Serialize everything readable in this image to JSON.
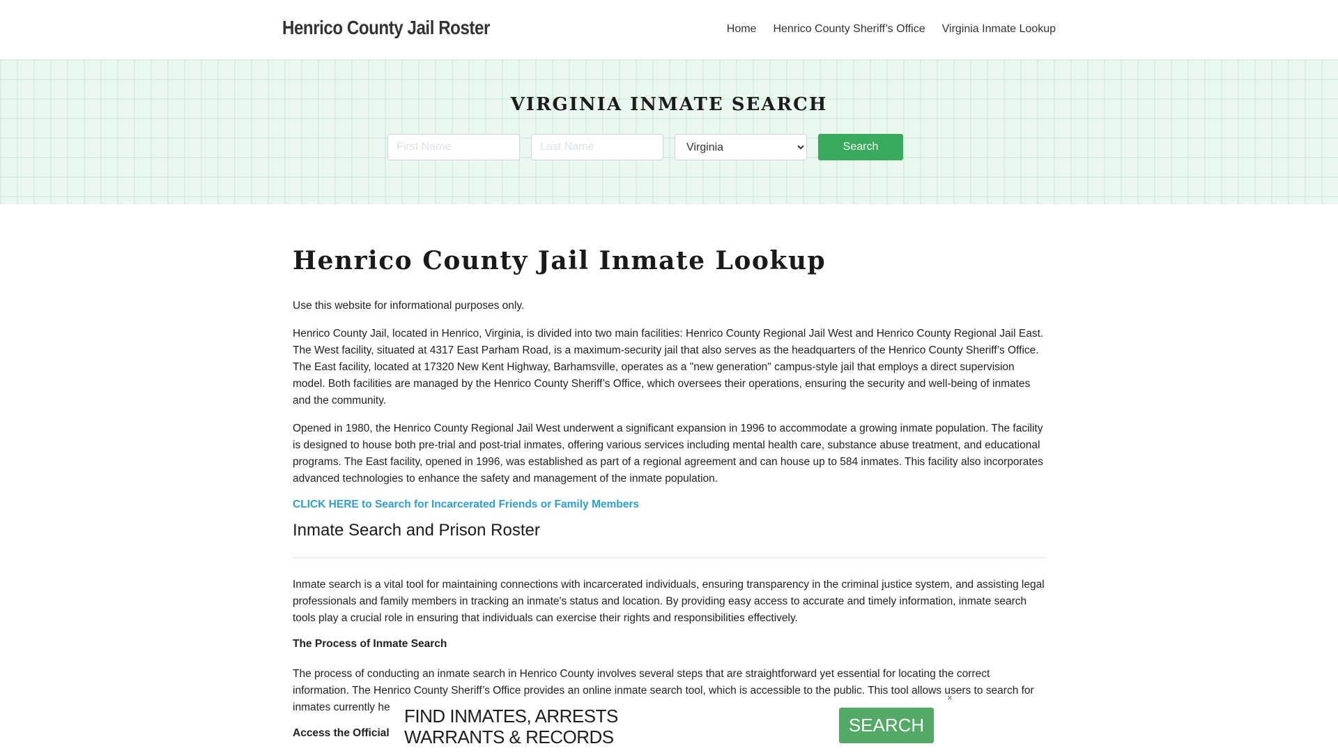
{
  "header": {
    "brand": "Henrico County Jail Roster",
    "nav": [
      {
        "label": "Home"
      },
      {
        "label": "Henrico County Sheriff’s Office"
      },
      {
        "label": "Virginia Inmate Lookup"
      }
    ]
  },
  "hero": {
    "title": "VIRGINIA INMATE SEARCH",
    "first_name_placeholder": "First Name",
    "last_name_placeholder": "Last Name",
    "state_selected": "Virginia",
    "search_label": "Search"
  },
  "main": {
    "title": "Henrico County Jail Inmate Lookup",
    "disclaimer": "Use this website for informational purposes only.",
    "paragraph1": "Henrico County Jail, located in Henrico, Virginia, is divided into two main facilities: Henrico County Regional Jail West and Henrico County Regional Jail East. The West facility, situated at 4317 East Parham Road, is a maximum-security jail that also serves as the headquarters of the Henrico County Sheriff’s Office. The East facility, located at 17320 New Kent Highway, Barhamsville, operates as a \"new generation\" campus-style jail that employs a direct supervision model. Both facilities are managed by the Henrico County Sheriff’s Office, which oversees their operations, ensuring the security and well-being of inmates and the community.",
    "paragraph2": "Opened in 1980, the Henrico County Regional Jail West underwent a significant expansion in 1996 to accommodate a growing inmate population. The facility is designed to house both pre-trial and post-trial inmates, offering various services including mental health care, substance abuse treatment, and educational programs. The East facility, opened in 1996, was established as part of a regional agreement and can house up to 584 inmates. This facility also incorporates advanced technologies to enhance the safety and management of the inmate population.",
    "cta_link": "CLICK HERE to Search for Incarcerated Friends or Family Members",
    "section_heading": "Inmate Search and Prison Roster",
    "paragraph3": "Inmate search is a vital tool for maintaining connections with incarcerated individuals, ensuring transparency in the criminal justice system, and assisting legal professionals and family members in tracking an inmate's status and location. By providing easy access to accurate and timely information, inmate search tools play a crucial role in ensuring that individuals can exercise their rights and responsibilities effectively.",
    "sub_heading": "The Process of Inmate Search",
    "paragraph4": "The process of conducting an inmate search in Henrico County involves several steps that are straightforward yet essential for locating the correct information. The Henrico County Sheriff’s Office provides an online inmate search tool, which is accessible to the public. This tool allows users to search for inmates currently he",
    "sub_heading2": "Access the Official I"
  },
  "ad": {
    "line1": "FIND INMATES, ARRESTS",
    "line2": "WARRANTS & RECORDS",
    "search_label": "SEARCH",
    "close_icon": "×"
  },
  "colors": {
    "accent_green": "#3aaa5d",
    "ad_green": "#53aa66",
    "link_blue": "#2c9fd9",
    "hero_bg": "#eaf8f1"
  }
}
